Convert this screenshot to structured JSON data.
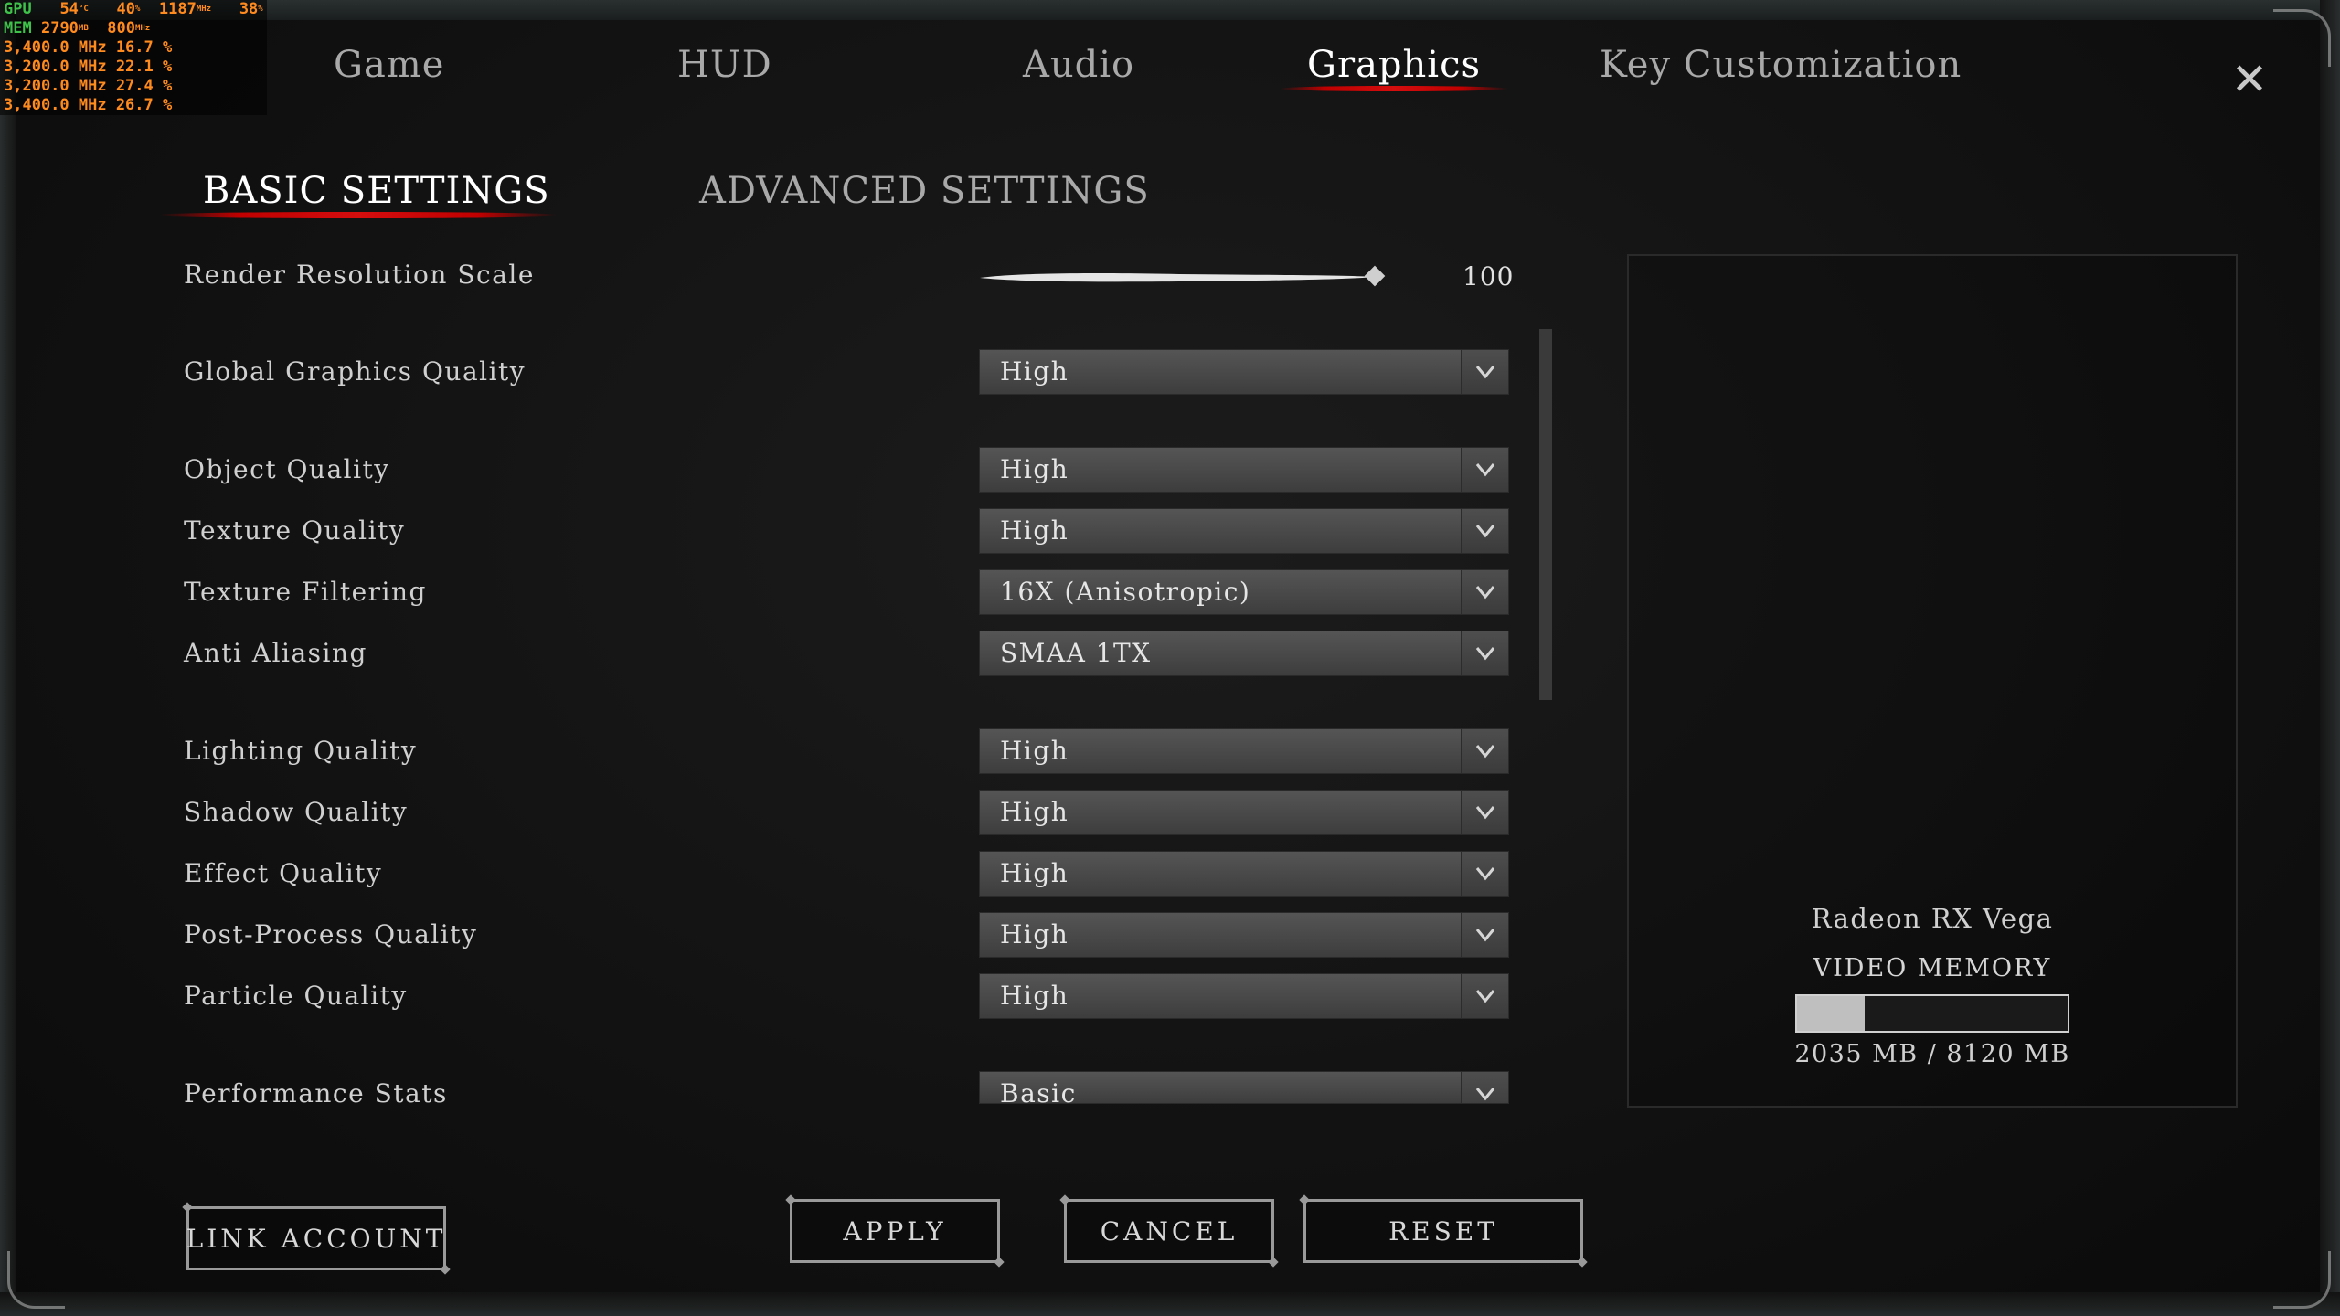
{
  "overlay": {
    "gpu_label": "GPU",
    "gpu_temp": "54",
    "gpu_temp_unit": "°C",
    "gpu_load": "40",
    "gpu_load_unit": "%",
    "gpu_clock": "1187",
    "gpu_clock_unit": "MHz",
    "gpu_fan": "38",
    "gpu_fan_unit": "%",
    "mem_label": "MEM",
    "mem_used": "2790",
    "mem_used_unit": "MB",
    "mem_clock": "800",
    "mem_clock_unit": "MHz",
    "cpu_lines": [
      "3,400.0 MHz 16.7 %",
      "3,200.0 MHz 22.1 %",
      "3,200.0 MHz 27.4 %",
      "3,400.0 MHz 26.7 %"
    ]
  },
  "tabs": [
    {
      "label": "Game",
      "active": false
    },
    {
      "label": "HUD",
      "active": false
    },
    {
      "label": "Audio",
      "active": false
    },
    {
      "label": "Graphics",
      "active": true
    },
    {
      "label": "Key Customization",
      "active": false
    }
  ],
  "close_icon": "close-icon",
  "subtabs": [
    {
      "label": "BASIC SETTINGS",
      "active": true
    },
    {
      "label": "ADVANCED SETTINGS",
      "active": false
    }
  ],
  "render_scale": {
    "label": "Render Resolution Scale",
    "value": "100",
    "fraction": 1.0
  },
  "settings": [
    {
      "label": "Global Graphics Quality",
      "value": "High"
    },
    {
      "label": "Object Quality",
      "value": "High"
    },
    {
      "label": "Texture Quality",
      "value": "High"
    },
    {
      "label": "Texture Filtering",
      "value": "16X (Anisotropic)"
    },
    {
      "label": "Anti Aliasing",
      "value": "SMAA 1TX"
    },
    {
      "label": "Lighting Quality",
      "value": "High"
    },
    {
      "label": "Shadow Quality",
      "value": "High"
    },
    {
      "label": "Effect Quality",
      "value": "High"
    },
    {
      "label": "Post-Process Quality",
      "value": "High"
    },
    {
      "label": "Particle Quality",
      "value": "High"
    },
    {
      "label": "Performance Stats",
      "value": "Basic"
    }
  ],
  "gpu_panel": {
    "gpu_name": "Radeon RX Vega",
    "vm_label": "VIDEO MEMORY",
    "vm_text": "2035 MB / 8120 MB",
    "vm_fraction": 0.25
  },
  "buttons": {
    "link_account": "LINK ACCOUNT",
    "apply": "APPLY",
    "cancel": "CANCEL",
    "reset": "RESET"
  },
  "colors": {
    "accent_red": "#c00000",
    "overlay_orange": "#ff8a1e",
    "overlay_green": "#3fc24a"
  }
}
